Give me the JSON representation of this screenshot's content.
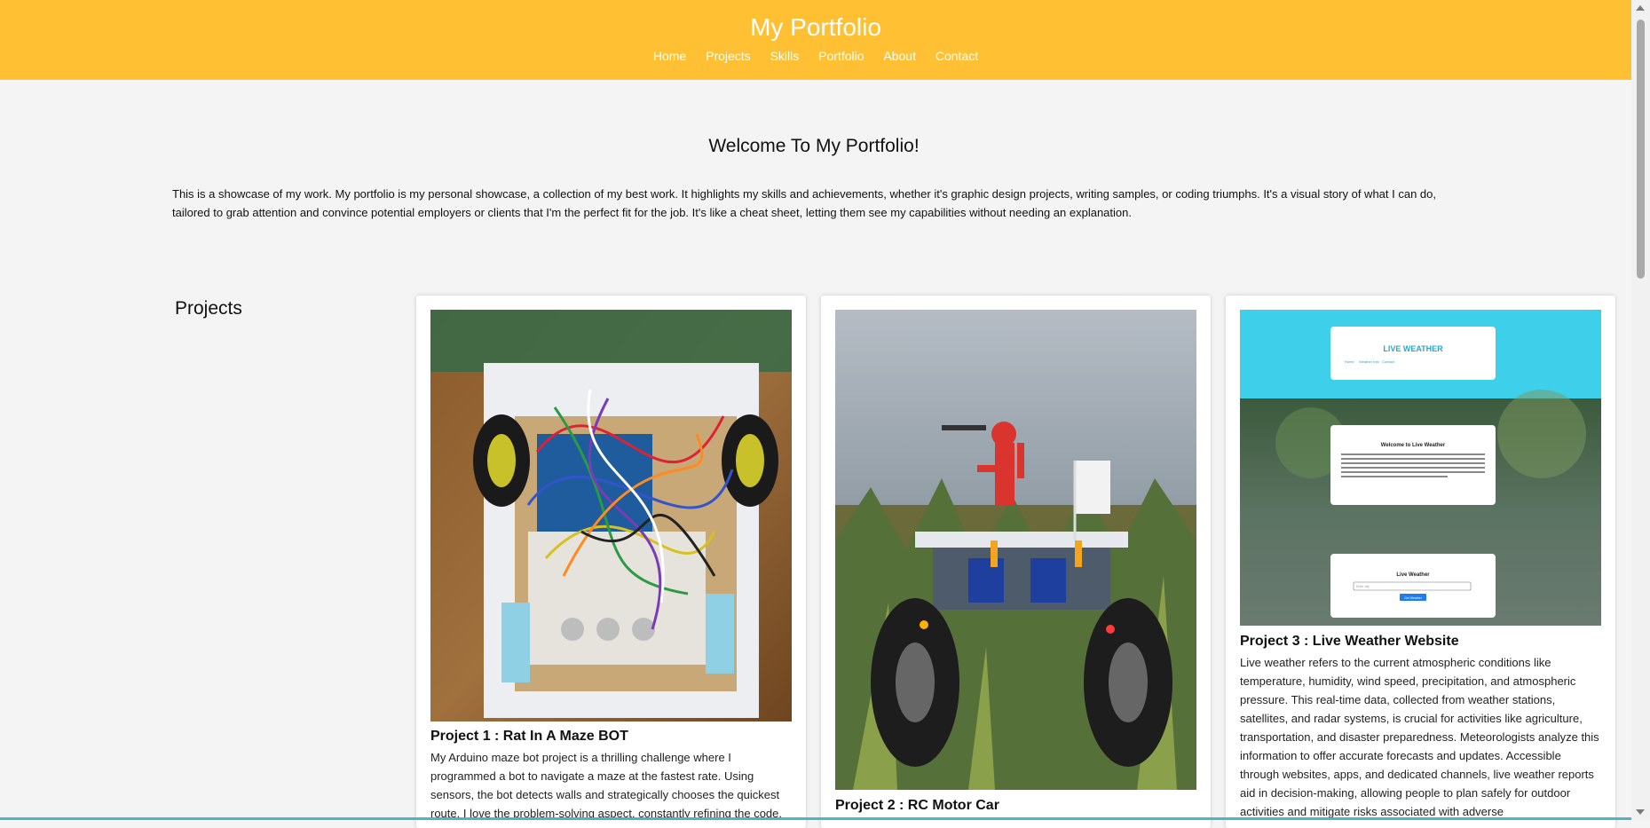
{
  "header": {
    "title": "My Portfolio",
    "nav": [
      "Home",
      "Projects",
      "Skills",
      "Portfolio",
      "About",
      "Contact"
    ],
    "background": "#ffc033"
  },
  "welcome": {
    "heading": "Welcome To My Portfolio!",
    "intro": "This is a showcase of my work. My portfolio is my personal showcase, a collection of my best work. It highlights my skills and achievements, whether it's graphic design projects, writing samples, or coding triumphs. It's a visual story of what I can do, tailored to grab attention and convince potential employers or clients that I'm the perfect fit for the job. It's like a cheat sheet, letting them see my capabilities without needing an explanation."
  },
  "projects": {
    "heading": "Projects",
    "items": [
      {
        "title": "Project 1 : Rat In A Maze BOT",
        "description": "My Arduino maze bot project is a thrilling challenge where I programmed a bot to navigate a maze at the fastest rate. Using sensors, the bot detects walls and strategically chooses the quickest route. I love the problem-solving aspect, constantly refining the code."
      },
      {
        "title": "Project 2 : RC Motor Car",
        "description": ""
      },
      {
        "title": "Project 3 : Live Weather Website",
        "description": "Live weather refers to the current atmospheric conditions like temperature, humidity, wind speed, precipitation, and atmospheric pressure. This real-time data, collected from weather stations, satellites, and radar systems, is crucial for activities like agriculture, transportation, and disaster preparedness. Meteorologists analyze this information to offer accurate forecasts and updates. Accessible through websites, apps, and dedicated channels, live weather reports aid in decision-making, allowing people to plan safely for outdoor activities and mitigate risks associated with adverse",
        "screenshot": {
          "site_title": "LIVE WEATHER",
          "nav": [
            "Home",
            "Weather Info",
            "Contact"
          ],
          "welcome_heading": "Welcome to Live Weather",
          "form_heading": "Live Weather",
          "input_placeholder": "Enter city",
          "button_label": "Get Weather"
        }
      }
    ]
  }
}
